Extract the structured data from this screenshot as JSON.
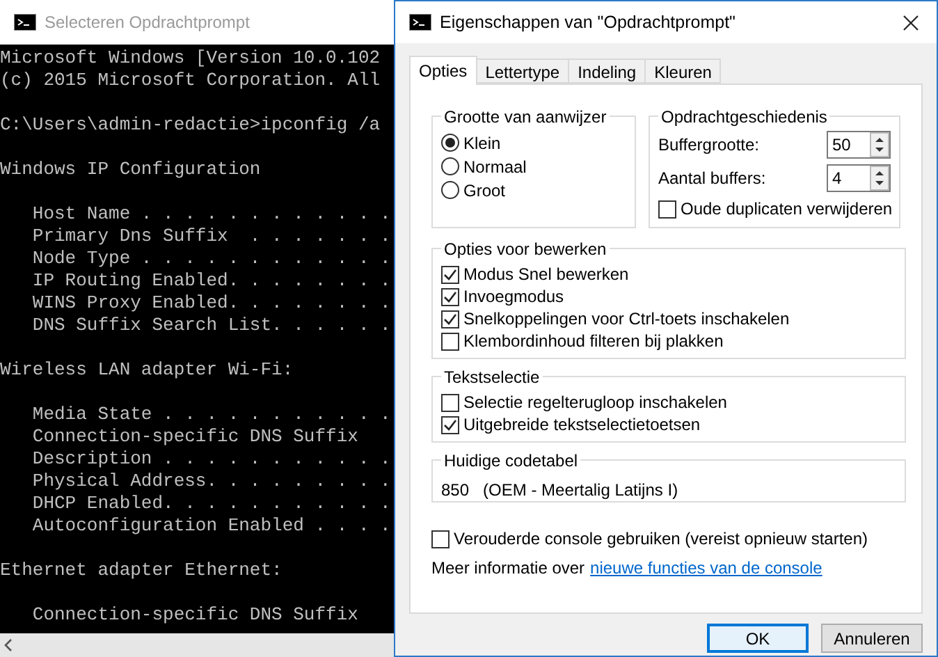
{
  "console": {
    "title": "Selecteren Opdrachtprompt",
    "blocks": [
      {
        "lines": [
          "Microsoft Windows [Version 10.0.102",
          "(c) 2015 Microsoft Corporation. All"
        ]
      },
      {
        "lines": [
          "C:\\Users\\admin-redactie>ipconfig /a"
        ]
      },
      {
        "lines": [
          "Windows IP Configuration"
        ]
      },
      {
        "lines": [
          "   Host Name . . . . . . . . . . . .",
          "   Primary Dns Suffix  . . . . . . .",
          "   Node Type . . . . . . . . . . . .",
          "   IP Routing Enabled. . . . . . . .",
          "   WINS Proxy Enabled. . . . . . . .",
          "   DNS Suffix Search List. . . . . ."
        ]
      },
      {
        "lines": [
          "Wireless LAN adapter Wi-Fi:"
        ]
      },
      {
        "lines": [
          "   Media State . . . . . . . . . . .",
          "   Connection-specific DNS Suffix",
          "   Description . . . . . . . . . . .",
          "   Physical Address. . . . . . . . .",
          "   DHCP Enabled. . . . . . . . . . .",
          "   Autoconfiguration Enabled . . . ."
        ]
      },
      {
        "lines": [
          "Ethernet adapter Ethernet:"
        ]
      },
      {
        "lines": [
          "   Connection-specific DNS Suffix"
        ]
      }
    ]
  },
  "dialog": {
    "title": "Eigenschappen van \"Opdrachtprompt\"",
    "tabs": [
      {
        "label": "Opties",
        "selected": true
      },
      {
        "label": "Lettertype",
        "selected": false
      },
      {
        "label": "Indeling",
        "selected": false
      },
      {
        "label": "Kleuren",
        "selected": false
      }
    ],
    "cursor_size": {
      "title": "Grootte van aanwijzer",
      "options": [
        {
          "label": "Klein",
          "selected": true
        },
        {
          "label": "Normaal",
          "selected": false
        },
        {
          "label": "Groot",
          "selected": false
        }
      ]
    },
    "history": {
      "title": "Opdrachtgeschiedenis",
      "fields": [
        {
          "label": "Buffergrootte:",
          "value": "50"
        },
        {
          "label": "Aantal buffers:",
          "value": "4"
        }
      ],
      "checkbox": {
        "label": "Oude duplicaten verwijderen",
        "checked": false
      }
    },
    "edit_options": {
      "title": "Opties voor bewerken",
      "items": [
        {
          "label": "Modus Snel bewerken",
          "checked": true
        },
        {
          "label": "Invoegmodus",
          "checked": true
        },
        {
          "label": "Snelkoppelingen voor Ctrl-toets inschakelen",
          "checked": true
        },
        {
          "label": "Klembordinhoud filteren bij plakken",
          "checked": false
        }
      ]
    },
    "text_selection": {
      "title": "Tekstselectie",
      "items": [
        {
          "label": "Selectie regelterugloop inschakelen",
          "checked": false
        },
        {
          "label": "Uitgebreide tekstselectietoetsen",
          "checked": true
        }
      ]
    },
    "codepage": {
      "title": "Huidige codetabel",
      "number": "850",
      "name": "(OEM - Meertalig Latijns I)"
    },
    "legacy": {
      "label": "Verouderde console gebruiken (vereist opnieuw starten)",
      "checked": false
    },
    "info": {
      "text": "Meer informatie over",
      "link": "nieuwe functies van de console"
    },
    "buttons": [
      {
        "label": "OK",
        "default": true
      },
      {
        "label": "Annuleren",
        "default": false
      }
    ]
  }
}
